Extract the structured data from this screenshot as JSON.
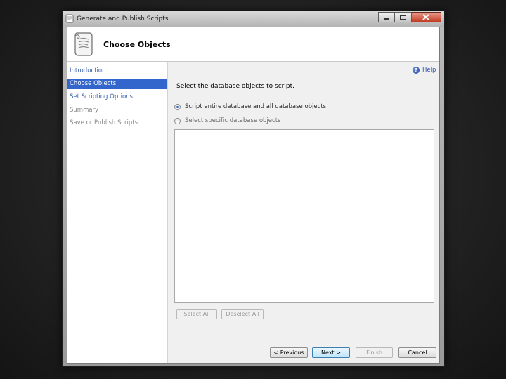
{
  "window": {
    "title": "Generate and Publish Scripts",
    "controls": [
      "minimize-icon",
      "maximize-icon",
      "close-icon"
    ]
  },
  "header": {
    "title": "Choose Objects",
    "icon": "script-scroll-icon"
  },
  "nav": {
    "items": [
      {
        "label": "Introduction",
        "state": "link"
      },
      {
        "label": "Choose Objects",
        "state": "active"
      },
      {
        "label": "Set Scripting Options",
        "state": "link"
      },
      {
        "label": "Summary",
        "state": "disabled"
      },
      {
        "label": "Save or Publish Scripts",
        "state": "disabled"
      }
    ]
  },
  "help": {
    "label": "Help"
  },
  "main": {
    "instruction": "Select the database objects to script.",
    "options": [
      {
        "label": "Script entire database and all database objects",
        "checked": true
      },
      {
        "label": "Select specific database objects",
        "checked": false
      }
    ],
    "select_all": "Select All",
    "deselect_all": "Deselect All"
  },
  "footer": {
    "previous": "< Previous",
    "next": "Next >",
    "finish": "Finish",
    "cancel": "Cancel"
  },
  "colors": {
    "accent": "#3366cc",
    "link": "#3a5fa8"
  }
}
